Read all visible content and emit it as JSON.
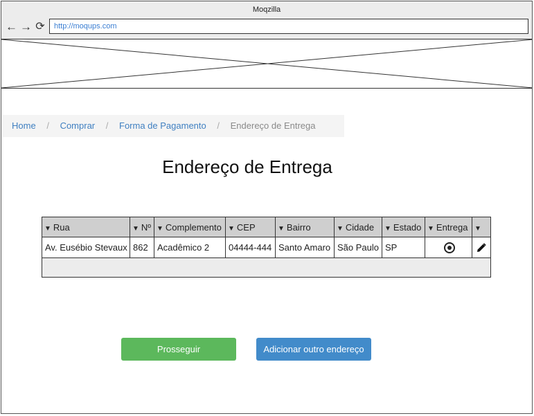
{
  "browser": {
    "title": "Moqzilla",
    "url": "http://moqups.com"
  },
  "breadcrumb": {
    "items": [
      "Home",
      "Comprar",
      "Forma de Pagamento",
      "Endereço de Entrega"
    ],
    "separator": "/"
  },
  "page": {
    "title": "Endereço de Entrega"
  },
  "table": {
    "headers": [
      "Rua",
      "Nº",
      "Complemento",
      "CEP",
      "Bairro",
      "Cidade",
      "Estado",
      "Entrega",
      ""
    ],
    "row": {
      "rua": "Av. Eusébio Stevaux",
      "numero": "862",
      "complemento": "Acadêmico 2",
      "cep": "04444-444",
      "bairro": "Santo Amaro",
      "cidade": "São Paulo",
      "estado": "SP"
    },
    "header_icon": "sort-arrow-icon",
    "selected_icon": "radio-selected-icon",
    "edit_icon": "pencil-icon"
  },
  "buttons": {
    "proceed": "Prosseguir",
    "add_address": "Adicionar outro endereço"
  },
  "colors": {
    "link": "#3f7fc1",
    "proceed": "#5cb85c",
    "add_address": "#428bca",
    "header_bg": "#cfcfcf"
  }
}
